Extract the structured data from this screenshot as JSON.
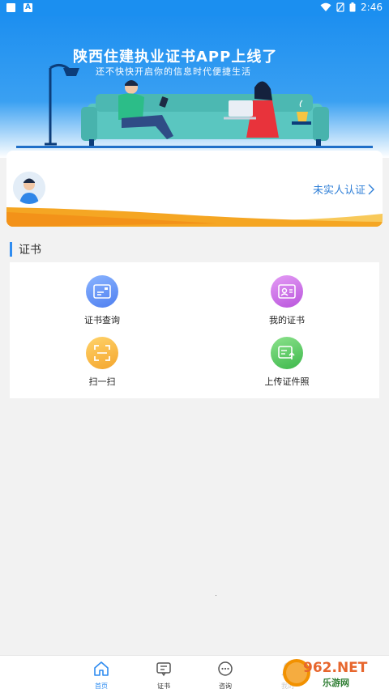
{
  "status_bar": {
    "time": "2:46"
  },
  "banner": {
    "title": "陕西住建执业证书APP上线了",
    "subtitle": "还不快快开启你的信息时代便捷生活"
  },
  "user_card": {
    "verify_label": "未实人认证"
  },
  "section": {
    "title": "证书"
  },
  "tiles": [
    {
      "label": "证书查询",
      "icon": "certificate-search-icon",
      "color": "#5b8ff0"
    },
    {
      "label": "我的证书",
      "icon": "my-certificate-icon",
      "color": "#c56ae0"
    },
    {
      "label": "扫一扫",
      "icon": "scan-icon",
      "color": "#f7b948"
    },
    {
      "label": "上传证件照",
      "icon": "upload-photo-icon",
      "color": "#5cc95c"
    }
  ],
  "tab_bar": {
    "tabs": [
      {
        "label": "首页",
        "icon": "home-icon",
        "active": true
      },
      {
        "label": "证书",
        "icon": "certificate-tab-icon",
        "active": false
      },
      {
        "label": "咨询",
        "icon": "chat-icon",
        "active": false
      },
      {
        "label": "我的",
        "icon": "profile-icon",
        "active": false
      }
    ]
  },
  "watermark": {
    "text": "962.NET",
    "subtext": "乐游网"
  },
  "colors": {
    "primary": "#1b8ff0",
    "accent_orange": "#f5a623"
  }
}
